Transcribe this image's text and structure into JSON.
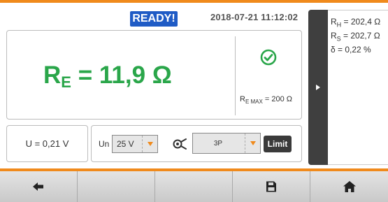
{
  "status": {
    "label": "READY!",
    "datetime": "2018-07-21 11:12:02"
  },
  "result": {
    "symbol": "R",
    "subscript": "E",
    "value": " = 11,9 Ω"
  },
  "limit_info": {
    "symbol": "R",
    "subscript": "E MAX",
    "value": " = 200 Ω"
  },
  "voltage": {
    "label": "U = 0,21 V"
  },
  "params": {
    "un_label": "Un",
    "un_value": "25 V",
    "mode_value": "3P",
    "limit_button": "Limit"
  },
  "side_panel": {
    "lines": [
      {
        "symbol": "R",
        "subscript": "H",
        "value": " = 202,4 Ω"
      },
      {
        "symbol": "R",
        "subscript": "S",
        "value": " = 202,7 Ω"
      },
      {
        "symbol": "δ",
        "subscript": "",
        "value": "  = 0,22 %"
      }
    ]
  },
  "toolbar": {
    "buttons": [
      "back-icon",
      "",
      "",
      "save-icon",
      "home-icon"
    ]
  },
  "colors": {
    "accent": "#f08a1c",
    "result_green": "#2aa64a",
    "ready_blue": "#1f5bc5"
  }
}
